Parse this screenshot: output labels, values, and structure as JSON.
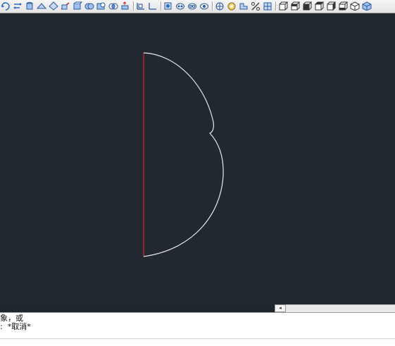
{
  "toolbar": {
    "icons": [
      "rotate-arrow-icon",
      "swap-arrow-icon",
      "cylinder-icon",
      "wedge-icon",
      "diamond-icon",
      "slice-icon",
      "box-solid-icon",
      "union-icon",
      "subtract-icon",
      "intersect-icon",
      "extrude-icon",
      "ucs-icon",
      "ucs-angle-icon",
      "view-icon",
      "orbit-icon",
      "free-orbit-icon",
      "continuous-orbit-icon",
      "render-icon",
      "light-icon",
      "material-icon",
      "percent-icon",
      "grid-icon",
      "front-view-icon",
      "back-view-icon",
      "left-view-icon",
      "right-view-icon",
      "top-view-icon",
      "bottom-view-icon",
      "iso-view-icon",
      "shade-icon"
    ]
  },
  "colors": {
    "canvas_bg": "#212830",
    "profile_curve": "#e8e8e8",
    "axis_line": "#d0202a"
  },
  "command_line": {
    "line1": "象，或",
    "line2_prefix": ":",
    "line2_value": "*取消*"
  }
}
